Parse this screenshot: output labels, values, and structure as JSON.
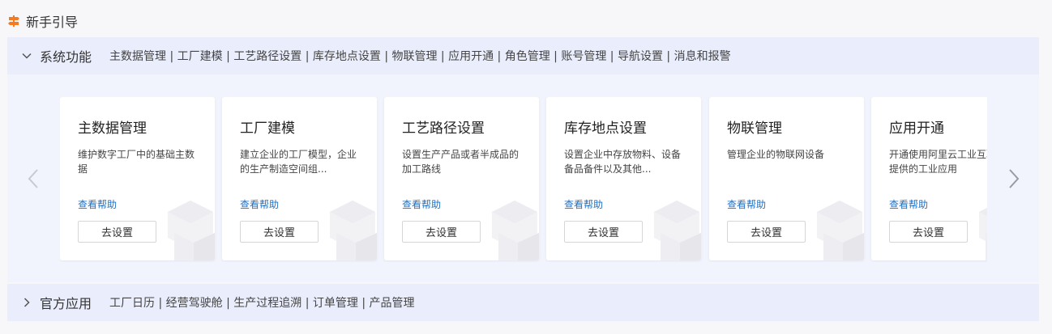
{
  "page": {
    "title": "新手引导",
    "icon": "signpost-icon",
    "accent": "#f47b20"
  },
  "system_section": {
    "title": "系统功能",
    "expanded": true,
    "links": "主数据管理 | 工厂建模 | 工艺路径设置 | 库存地点设置 | 物联管理 | 应用开通 | 角色管理 | 账号管理 | 导航设置 | 消息和报警",
    "cards": [
      {
        "title": "主数据管理",
        "desc": "维护数字工厂中的基础主数据",
        "help": "查看帮助",
        "button": "去设置"
      },
      {
        "title": "工厂建模",
        "desc": "建立企业的工厂模型，企业的生产制造空间组...",
        "help": "查看帮助",
        "button": "去设置"
      },
      {
        "title": "工艺路径设置",
        "desc": "设置生产产品或者半成品的加工路线",
        "help": "查看帮助",
        "button": "去设置"
      },
      {
        "title": "库存地点设置",
        "desc": "设置企业中存放物料、设备备品备件以及其他...",
        "help": "查看帮助",
        "button": "去设置"
      },
      {
        "title": "物联管理",
        "desc": "管理企业的物联网设备",
        "help": "查看帮助",
        "button": "去设置"
      },
      {
        "title": "应用开通",
        "desc": "开通使用阿里云工业互联网提供的工业应用",
        "help": "查看帮助",
        "button": "去设置"
      }
    ]
  },
  "official_section": {
    "title": "官方应用",
    "expanded": false,
    "links": "工厂日历 | 经营驾驶舱 | 生产过程追溯 | 订单管理 | 产品管理"
  },
  "colors": {
    "link_blue": "#1f6fc4",
    "section_bg": "#eaeefc"
  }
}
